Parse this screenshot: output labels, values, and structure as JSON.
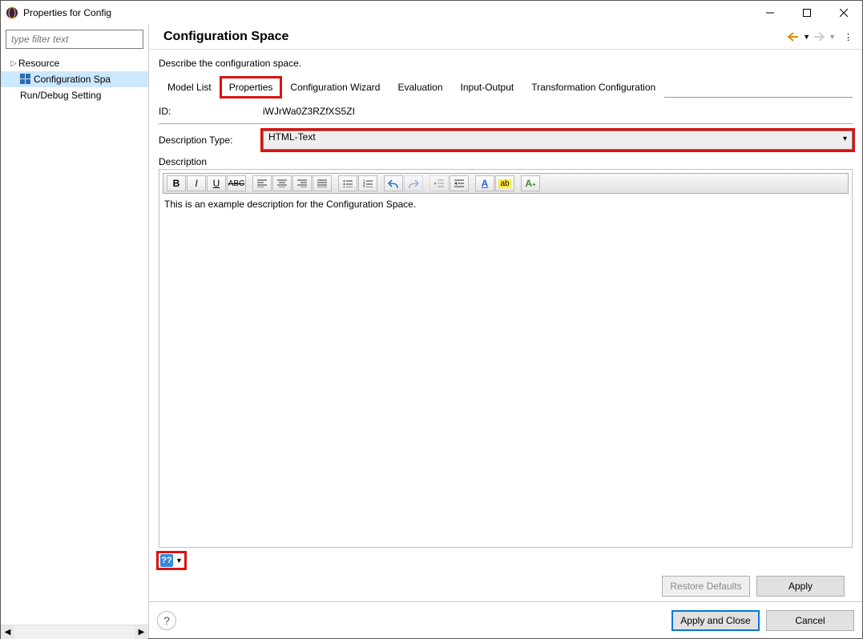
{
  "window": {
    "title": "Properties for Config"
  },
  "sidebar": {
    "filter_placeholder": "type filter text",
    "items": [
      {
        "label": "Resource",
        "expandable": true
      },
      {
        "label": "Configuration Spa",
        "selected": true
      },
      {
        "label": "Run/Debug Setting"
      }
    ]
  },
  "page": {
    "heading": "Configuration Space",
    "subheading": "Describe the configuration space."
  },
  "tabs": [
    {
      "label": "Model List"
    },
    {
      "label": "Properties",
      "active": true,
      "highlight": true
    },
    {
      "label": "Configuration Wizard"
    },
    {
      "label": "Evaluation"
    },
    {
      "label": "Input-Output"
    },
    {
      "label": "Transformation Configuration"
    }
  ],
  "properties": {
    "id_label": "ID:",
    "id_value": "iWJrWa0Z3RZfXS5ZI",
    "desc_type_label": "Description Type:",
    "desc_type_value": "HTML-Text",
    "desc_label": "Description",
    "desc_content": "This is an example description for the Configuration Space."
  },
  "buttons": {
    "restore_defaults": "Restore Defaults",
    "apply": "Apply",
    "apply_close": "Apply and Close",
    "cancel": "Cancel"
  },
  "toolbar_icons": [
    "bold",
    "italic",
    "underline",
    "strike",
    "align-left",
    "align-center",
    "align-right",
    "align-justify",
    "ul",
    "ol",
    "undo",
    "redo",
    "outdent",
    "indent",
    "font-color",
    "highlight",
    "insert"
  ]
}
